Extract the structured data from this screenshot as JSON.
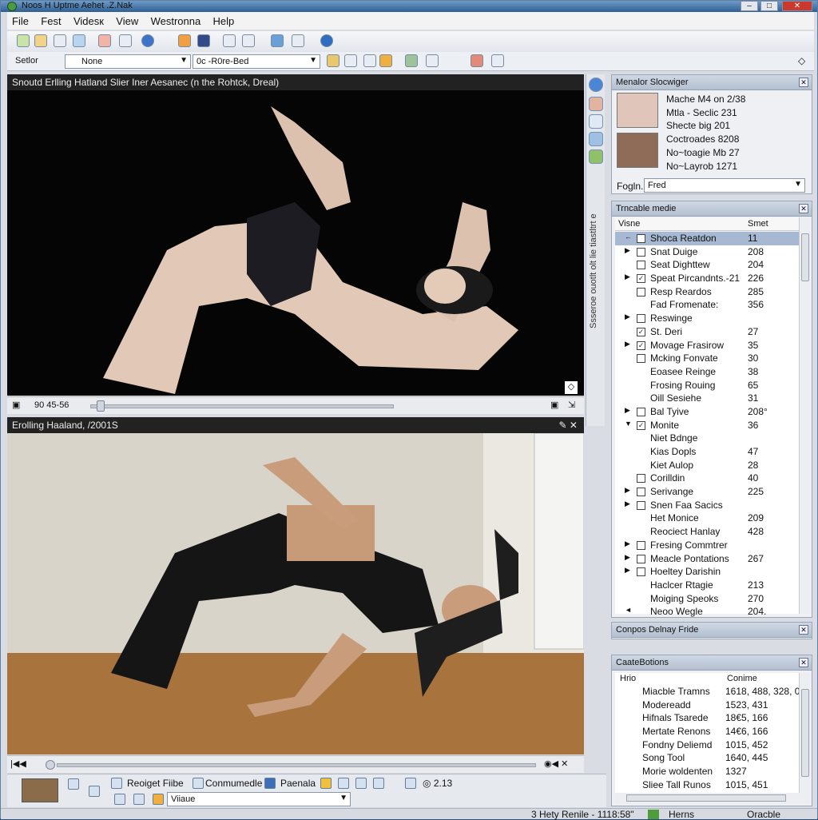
{
  "window": {
    "title": "Noos H Uptme Aehet .Z.Nak",
    "min": "–",
    "max": "□",
    "close": "✕"
  },
  "menu": [
    "File",
    "Fest",
    "Videsк",
    "View",
    "Westronna",
    "Help"
  ],
  "address": {
    "label": "Setlor",
    "select1": "None",
    "select2": "0c -R0re-Bed"
  },
  "top_video": {
    "title": "Snoutd Erlling Hatland Slier Iner Aesanec (n the Rohtck, Dreal)",
    "timecode": "90  45-56",
    "progress": 0.02
  },
  "bottom_video": {
    "title": "Erolling Haaland, /2001S",
    "progress": 0.0
  },
  "side_vertical_text": "Ssseroe ouotlt olt lie tiastltrt e",
  "sampler": {
    "title": "Menalor Slocwiger",
    "lines": [
      "Mache M4 on 2/38",
      "Mtla - Seclic 231",
      "Shecte big 201",
      "Coctroades 8208",
      "No~toagie Mb 27",
      "No~Layrob 1271"
    ],
    "filter_label": "Fogln.",
    "filter_value": "Fred"
  },
  "media": {
    "title": "Trncable medie",
    "col_name": "Visne",
    "col_size": "Smet",
    "rows": [
      {
        "exp": "←",
        "cb": "sel",
        "name": "Shoca Reatdon",
        "size": "11"
      },
      {
        "exp": "▶",
        "cb": "",
        "name": "Snat Duige",
        "size": "208"
      },
      {
        "exp": "",
        "cb": "",
        "name": "Seat Dighttew",
        "size": "204"
      },
      {
        "exp": "▶",
        "cb": "✓",
        "name": "Speat Pircandnts.-21",
        "size": "226"
      },
      {
        "exp": "",
        "cb": "",
        "name": "Resp Reardos",
        "size": "285"
      },
      {
        "exp": "",
        "cb": "none",
        "name": "Fad Fromenate:",
        "size": "356"
      },
      {
        "exp": "▶",
        "cb": "",
        "name": "Reswinge",
        "size": ""
      },
      {
        "exp": "",
        "cb": "✓",
        "name": "St. Deri",
        "size": "27"
      },
      {
        "exp": "▶",
        "cb": "✓",
        "name": "Movage Frasirow",
        "size": "35"
      },
      {
        "exp": "",
        "cb": "",
        "name": "Mcking Fonvate",
        "size": "30"
      },
      {
        "exp": "",
        "cb": "none",
        "name": "Eoasee Reinge",
        "size": "38"
      },
      {
        "exp": "",
        "cb": "none",
        "name": "Frosing Rouing",
        "size": "65"
      },
      {
        "exp": "",
        "cb": "none",
        "name": "Oill Sesiehe",
        "size": "31"
      },
      {
        "exp": "▶",
        "cb": "",
        "name": "Bal Tyive",
        "size": "208°"
      },
      {
        "exp": "▼",
        "cb": "✓",
        "name": "Monite",
        "size": "36"
      },
      {
        "exp": "",
        "cb": "none",
        "name": "Niet Bdnge",
        "size": ""
      },
      {
        "exp": "",
        "cb": "none",
        "name": "Kias Dopls",
        "size": "47"
      },
      {
        "exp": "",
        "cb": "none",
        "name": "Kiet Aulop",
        "size": "28"
      },
      {
        "exp": "",
        "cb": "",
        "name": "Corilldin",
        "size": "40"
      },
      {
        "exp": "▶",
        "cb": "",
        "name": "Serivange",
        "size": "225"
      },
      {
        "exp": "▶",
        "cb": "",
        "name": "Snen Faa Sacics",
        "size": ""
      },
      {
        "exp": "",
        "cb": "none",
        "name": "Het Monice",
        "size": "209"
      },
      {
        "exp": "",
        "cb": "none",
        "name": "Reociect Hanlay",
        "size": "428"
      },
      {
        "exp": "▶",
        "cb": "",
        "name": "Fresing Commtrer",
        "size": ""
      },
      {
        "exp": "▶",
        "cb": "",
        "name": "Meacle Pontations",
        "size": "267"
      },
      {
        "exp": "▶",
        "cb": "",
        "name": "Hoeltey Darishin",
        "size": ""
      },
      {
        "exp": "",
        "cb": "none",
        "name": "Haclcer Rtagie",
        "size": "213"
      },
      {
        "exp": "",
        "cb": "none",
        "name": "Moiging Speoks",
        "size": "270"
      },
      {
        "exp": "◄",
        "cb": "none",
        "name": "Neoo Wegle",
        "size": "204."
      }
    ]
  },
  "compose": {
    "title": "Conpos Delnay Fride"
  },
  "capture": {
    "title": "CaateBotions",
    "col_name": "Hrio",
    "col_val": "Conime",
    "rows": [
      {
        "name": "Miacble Tramns",
        "val": "1618, 488, 328, 0"
      },
      {
        "name": "Modereadd",
        "val": "1523, 431"
      },
      {
        "name": "Hifnals Tsarede",
        "val": "18€5, 166"
      },
      {
        "name": "Mertate Renons",
        "val": "14€6, 166"
      },
      {
        "name": "Fondny Deliemd",
        "val": "1015, 452"
      },
      {
        "name": "Song Tool",
        "val": "1640, 445"
      },
      {
        "name": "Morie woldenten",
        "val": "1327"
      },
      {
        "name": "Sliee Tall Runos",
        "val": "1015, 451"
      }
    ]
  },
  "bottom": {
    "btn1": "Reoiget Fiibe",
    "btn2": "Conmumedle",
    "btn3": "Paenala",
    "counter": "2.13",
    "select": "Viiaue"
  },
  "status": {
    "center": "3 Hety Renile - 1118:58\"",
    "right1": "Herns",
    "right2": "Oracble"
  }
}
